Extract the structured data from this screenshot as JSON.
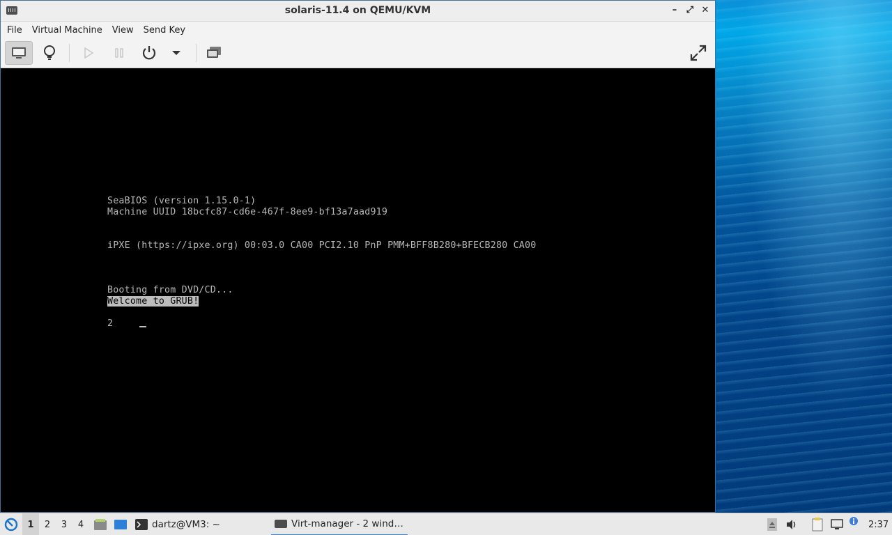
{
  "window": {
    "title": "solaris-11.4 on QEMU/KVM",
    "controls": {
      "minimize": "–",
      "maximize": "⤢",
      "close": "✕"
    }
  },
  "menubar": {
    "items": [
      "File",
      "Virtual Machine",
      "View",
      "Send Key"
    ]
  },
  "toolbar": {
    "icons": [
      "monitor-icon",
      "lightbulb-icon",
      "play-icon",
      "pause-icon",
      "power-icon",
      "dropdown-arrow-icon",
      "screenshot-icon",
      "fullscreen-icon"
    ]
  },
  "console": {
    "lines": [
      "SeaBIOS (version 1.15.0-1)",
      "Machine UUID 18bcfc87-cd6e-467f-8ee9-bf13a7aad919",
      "iPXE (https://ipxe.org) 00:03.0 CA00 PCI2.10 PnP PMM+BFF8B280+BFECB280 CA00",
      "Booting from DVD/CD...",
      "Welcome to GRUB!",
      "2"
    ]
  },
  "taskbar": {
    "workspaces": [
      "1",
      "2",
      "3",
      "4"
    ],
    "active_workspace": "1",
    "tasks": [
      {
        "label": "dartz@VM3: ~",
        "icon": "terminal-icon"
      },
      {
        "label": "Virt-manager - 2 wind…",
        "icon": "virt-manager-icon"
      }
    ],
    "clock": "2:37"
  },
  "colors": {
    "taskbar_active_underline": "#3584e4",
    "console_bg": "#000000",
    "console_text": "#b8b8b8"
  }
}
